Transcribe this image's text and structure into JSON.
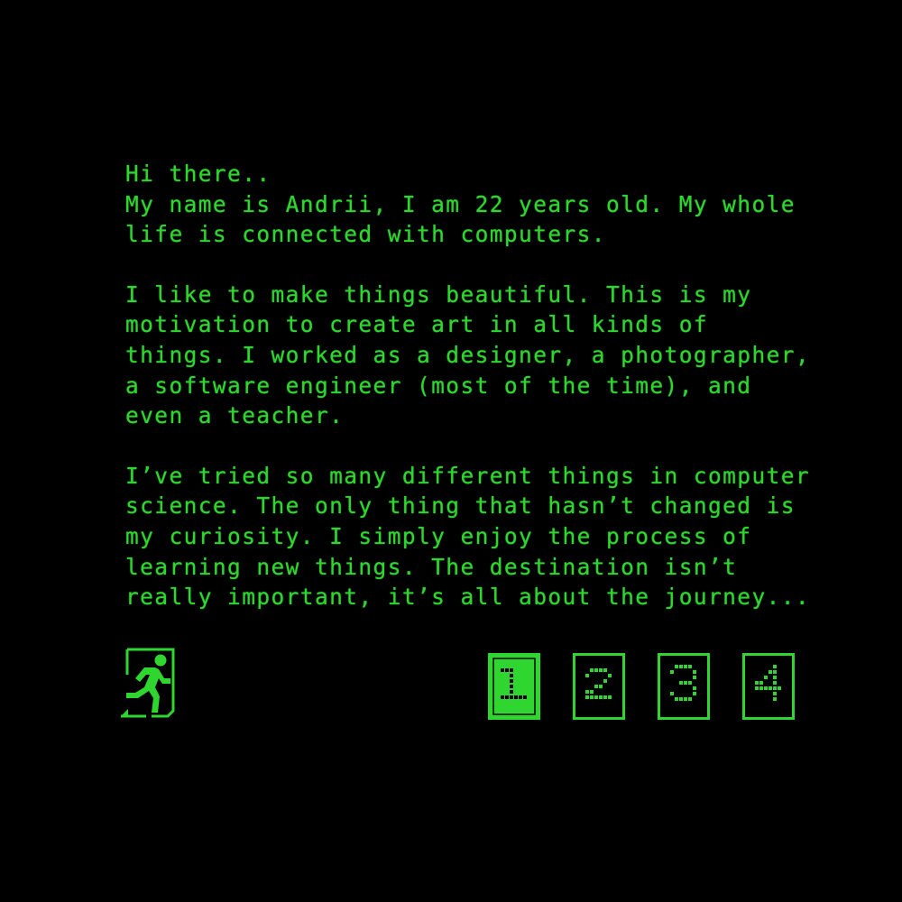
{
  "about": {
    "greeting": "Hi there..",
    "intro": "My name is Andrii, I am 22 years old. My whole life is connected with computers.",
    "paragraph_2": "I like to make things beautiful. This is my motivation to create art in all kinds of things. I worked as a designer, a photographer, a software engineer (most of the time), and even a teacher.",
    "paragraph_3": "I’ve tried so many different things in computer science. The only thing that hasn’t changed is my curiosity. I simply enjoy the process of learning new things. The destination isn’t really important, it’s all about the journey..."
  },
  "exit": {
    "icon": "exit-running-man-icon"
  },
  "pagination": {
    "current": 1,
    "pages": [
      "1",
      "2",
      "3",
      "4"
    ]
  },
  "colors": {
    "background": "#000000",
    "accent": "#2fd62f"
  }
}
